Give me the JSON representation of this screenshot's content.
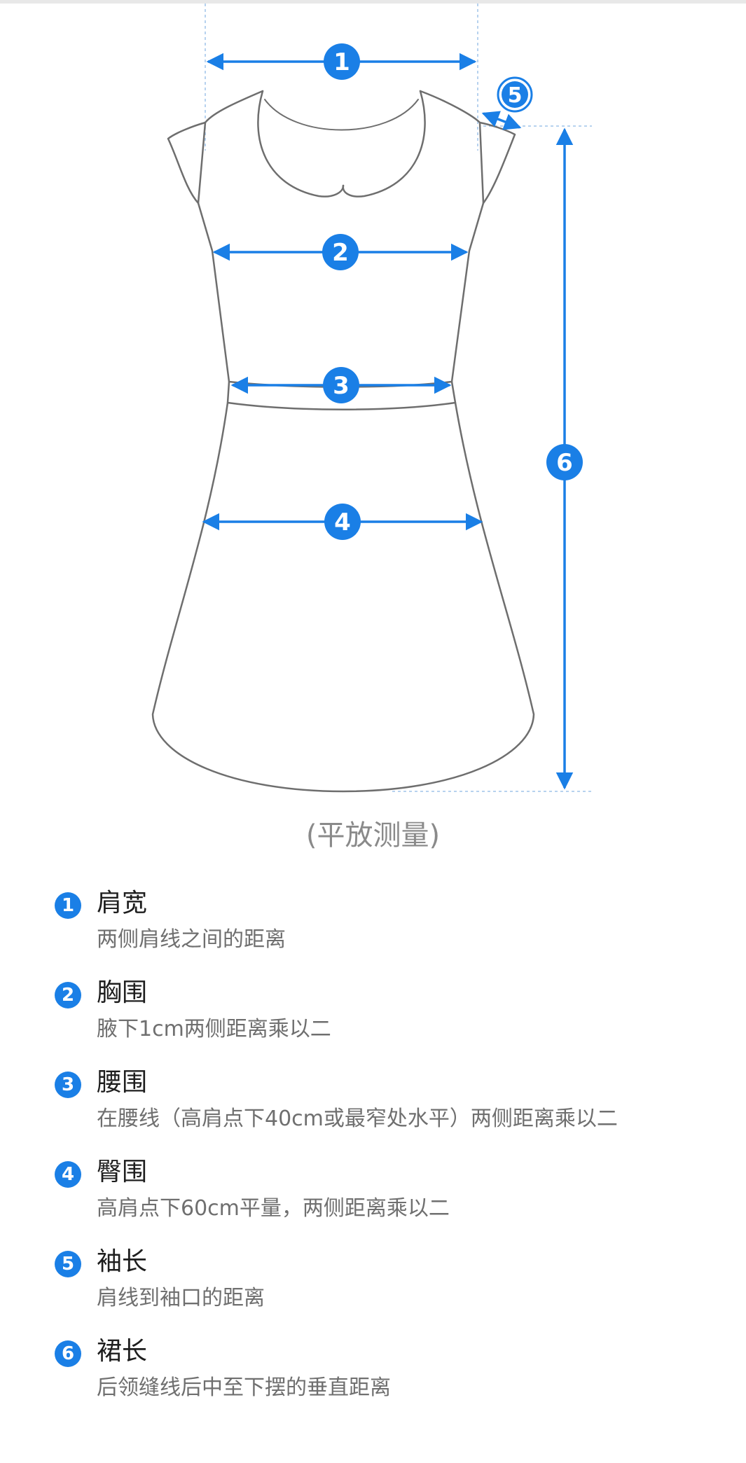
{
  "colors": {
    "accent": "#1a7fe6",
    "outline": "#6e6e6e",
    "guide": "#9fc4ea"
  },
  "markers": [
    "1",
    "2",
    "3",
    "4",
    "5",
    "6"
  ],
  "caption": "(平放测量)",
  "legend": [
    {
      "num": "1",
      "title": "肩宽",
      "desc": "两侧肩线之间的距离"
    },
    {
      "num": "2",
      "title": "胸围",
      "desc": "腋下1cm两侧距离乘以二"
    },
    {
      "num": "3",
      "title": "腰围",
      "desc": "在腰线（高肩点下40cm或最窄处水平）两侧距离乘以二"
    },
    {
      "num": "4",
      "title": "臀围",
      "desc": "高肩点下60cm平量，两侧距离乘以二"
    },
    {
      "num": "5",
      "title": "袖长",
      "desc": "肩线到袖口的距离"
    },
    {
      "num": "6",
      "title": "裙长",
      "desc": "后领缝线后中至下摆的垂直距离"
    }
  ]
}
